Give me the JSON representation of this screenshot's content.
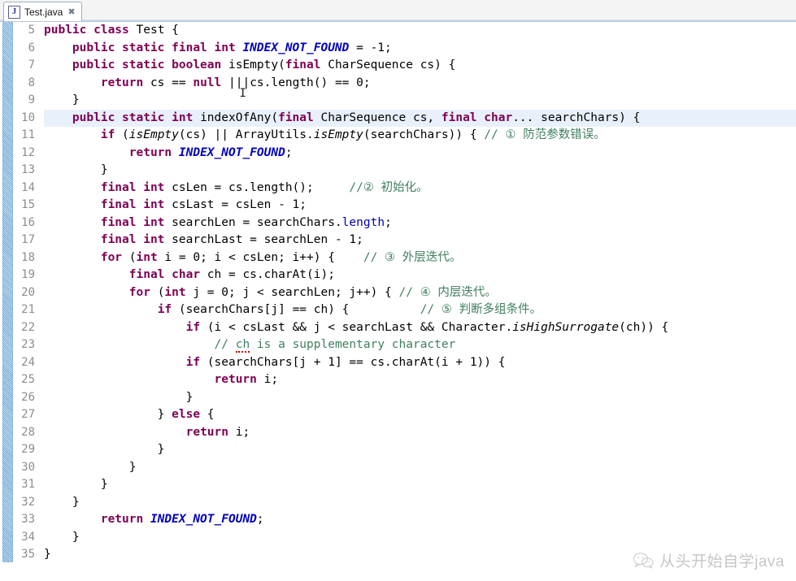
{
  "window": {
    "app": "eclipse-java-editor"
  },
  "tab": {
    "icon": "java-file-icon",
    "label": "Test.java",
    "close_glyph": "✖"
  },
  "gutter": {
    "first_line": 5,
    "last_line": 35,
    "fold_lines": [
      7,
      10
    ],
    "line_numbers": [
      5,
      6,
      7,
      8,
      9,
      10,
      11,
      12,
      13,
      14,
      15,
      16,
      17,
      18,
      19,
      20,
      21,
      22,
      23,
      24,
      25,
      26,
      27,
      28,
      29,
      30,
      31,
      32,
      33,
      34,
      35
    ]
  },
  "editor": {
    "current_line": 10,
    "colors": {
      "keyword": "#7f0055",
      "static_field": "#0000c0",
      "comment": "#3f7f5f",
      "string": "#2a00ff",
      "current_line_bg": "#e8f0fb",
      "background": "#ffffff",
      "line_number": "#8d8d8d"
    },
    "lines": [
      {
        "n": 5,
        "segments": [
          {
            "t": "public class ",
            "c": "kw"
          },
          {
            "t": "Test {",
            "c": "plain"
          }
        ]
      },
      {
        "n": 6,
        "segments": [
          {
            "t": "    ",
            "c": "plain"
          },
          {
            "t": "public static final int ",
            "c": "kw"
          },
          {
            "t": "INDEX_NOT_FOUND",
            "c": "sfld"
          },
          {
            "t": " = -1;",
            "c": "plain"
          }
        ]
      },
      {
        "n": 7,
        "segments": [
          {
            "t": "    ",
            "c": "plain"
          },
          {
            "t": "public static boolean ",
            "c": "kw"
          },
          {
            "t": "isEmpty(",
            "c": "plain"
          },
          {
            "t": "final ",
            "c": "kw"
          },
          {
            "t": "CharSequence cs) {",
            "c": "plain"
          }
        ]
      },
      {
        "n": 8,
        "segments": [
          {
            "t": "        ",
            "c": "plain"
          },
          {
            "t": "return ",
            "c": "kw"
          },
          {
            "t": "cs == ",
            "c": "plain"
          },
          {
            "t": "null",
            "c": "kw"
          },
          {
            "t": " ||",
            "c": "plain"
          },
          {
            "t": "|cs.length() == 0;",
            "c": "plain"
          }
        ]
      },
      {
        "n": 9,
        "segments": [
          {
            "t": "    }",
            "c": "plain"
          }
        ]
      },
      {
        "n": 10,
        "segments": [
          {
            "t": "    ",
            "c": "plain"
          },
          {
            "t": "public static int ",
            "c": "kw"
          },
          {
            "t": "indexOfAny(",
            "c": "plain"
          },
          {
            "t": "final ",
            "c": "kw"
          },
          {
            "t": "CharSequence cs, ",
            "c": "plain"
          },
          {
            "t": "final char",
            "c": "kw"
          },
          {
            "t": "... searchChars) {",
            "c": "plain"
          }
        ]
      },
      {
        "n": 11,
        "segments": [
          {
            "t": "        ",
            "c": "plain"
          },
          {
            "t": "if ",
            "c": "kw"
          },
          {
            "t": "(",
            "c": "plain"
          },
          {
            "t": "isEmpty",
            "c": "mth"
          },
          {
            "t": "(cs) || ArrayUtils.",
            "c": "plain"
          },
          {
            "t": "isEmpty",
            "c": "mth"
          },
          {
            "t": "(searchChars)) { ",
            "c": "plain"
          },
          {
            "t": "// ① 防范参数错误。",
            "c": "cmt"
          }
        ]
      },
      {
        "n": 12,
        "segments": [
          {
            "t": "            ",
            "c": "plain"
          },
          {
            "t": "return ",
            "c": "kw"
          },
          {
            "t": "INDEX_NOT_FOUND",
            "c": "sfld"
          },
          {
            "t": ";",
            "c": "plain"
          }
        ]
      },
      {
        "n": 13,
        "segments": [
          {
            "t": "        }",
            "c": "plain"
          }
        ]
      },
      {
        "n": 14,
        "segments": [
          {
            "t": "        ",
            "c": "plain"
          },
          {
            "t": "final int ",
            "c": "kw"
          },
          {
            "t": "csLen = cs.length();     ",
            "c": "plain"
          },
          {
            "t": "//② 初始化。",
            "c": "cmt"
          }
        ]
      },
      {
        "n": 15,
        "segments": [
          {
            "t": "        ",
            "c": "plain"
          },
          {
            "t": "final int ",
            "c": "kw"
          },
          {
            "t": "csLast = csLen - 1;",
            "c": "plain"
          }
        ]
      },
      {
        "n": 16,
        "segments": [
          {
            "t": "        ",
            "c": "plain"
          },
          {
            "t": "final int ",
            "c": "kw"
          },
          {
            "t": "searchLen = searchChars.",
            "c": "plain"
          },
          {
            "t": "length",
            "c": "fld"
          },
          {
            "t": ";",
            "c": "plain"
          }
        ]
      },
      {
        "n": 17,
        "segments": [
          {
            "t": "        ",
            "c": "plain"
          },
          {
            "t": "final int ",
            "c": "kw"
          },
          {
            "t": "searchLast = searchLen - 1;",
            "c": "plain"
          }
        ]
      },
      {
        "n": 18,
        "segments": [
          {
            "t": "        ",
            "c": "plain"
          },
          {
            "t": "for ",
            "c": "kw"
          },
          {
            "t": "(",
            "c": "plain"
          },
          {
            "t": "int ",
            "c": "kw"
          },
          {
            "t": "i = 0; i < csLen; i++) {    ",
            "c": "plain"
          },
          {
            "t": "// ③ 外层迭代。",
            "c": "cmt"
          }
        ]
      },
      {
        "n": 19,
        "segments": [
          {
            "t": "            ",
            "c": "plain"
          },
          {
            "t": "final char ",
            "c": "kw"
          },
          {
            "t": "ch = cs.charAt(i);",
            "c": "plain"
          }
        ]
      },
      {
        "n": 20,
        "segments": [
          {
            "t": "            ",
            "c": "plain"
          },
          {
            "t": "for ",
            "c": "kw"
          },
          {
            "t": "(",
            "c": "plain"
          },
          {
            "t": "int ",
            "c": "kw"
          },
          {
            "t": "j = 0; j < searchLen; j++) { ",
            "c": "plain"
          },
          {
            "t": "// ④ 内层迭代。",
            "c": "cmt"
          }
        ]
      },
      {
        "n": 21,
        "segments": [
          {
            "t": "                ",
            "c": "plain"
          },
          {
            "t": "if ",
            "c": "kw"
          },
          {
            "t": "(searchChars[j] == ch) {          ",
            "c": "plain"
          },
          {
            "t": "// ⑤ 判断多组条件。",
            "c": "cmt"
          }
        ]
      },
      {
        "n": 22,
        "segments": [
          {
            "t": "                    ",
            "c": "plain"
          },
          {
            "t": "if ",
            "c": "kw"
          },
          {
            "t": "(i < csLast && j < searchLast && Character.",
            "c": "plain"
          },
          {
            "t": "isHighSurrogate",
            "c": "mth"
          },
          {
            "t": "(ch)) {",
            "c": "plain"
          }
        ]
      },
      {
        "n": 23,
        "segments": [
          {
            "t": "                        ",
            "c": "plain"
          },
          {
            "t": "// ch is a supplementary character",
            "c": "cmt",
            "spell": "ch"
          }
        ]
      },
      {
        "n": 24,
        "segments": [
          {
            "t": "                    ",
            "c": "plain"
          },
          {
            "t": "if ",
            "c": "kw"
          },
          {
            "t": "(searchChars[j + 1] == cs.charAt(i + 1)) {",
            "c": "plain"
          }
        ]
      },
      {
        "n": 25,
        "segments": [
          {
            "t": "                        ",
            "c": "plain"
          },
          {
            "t": "return ",
            "c": "kw"
          },
          {
            "t": "i;",
            "c": "plain"
          }
        ]
      },
      {
        "n": 26,
        "segments": [
          {
            "t": "                    }",
            "c": "plain"
          }
        ]
      },
      {
        "n": 27,
        "segments": [
          {
            "t": "                } ",
            "c": "plain"
          },
          {
            "t": "else ",
            "c": "kw"
          },
          {
            "t": "{",
            "c": "plain"
          }
        ]
      },
      {
        "n": 28,
        "segments": [
          {
            "t": "                    ",
            "c": "plain"
          },
          {
            "t": "return ",
            "c": "kw"
          },
          {
            "t": "i;",
            "c": "plain"
          }
        ]
      },
      {
        "n": 29,
        "segments": [
          {
            "t": "                }",
            "c": "plain"
          }
        ]
      },
      {
        "n": 30,
        "segments": [
          {
            "t": "            }",
            "c": "plain"
          }
        ]
      },
      {
        "n": 31,
        "segments": [
          {
            "t": "        }",
            "c": "plain"
          }
        ]
      },
      {
        "n": 32,
        "segments": [
          {
            "t": "    }",
            "c": "plain"
          }
        ]
      },
      {
        "n": 33,
        "segments": [
          {
            "t": "        ",
            "c": "plain"
          },
          {
            "t": "return ",
            "c": "kw"
          },
          {
            "t": "INDEX_NOT_FOUND",
            "c": "sfld"
          },
          {
            "t": ";",
            "c": "plain"
          }
        ]
      },
      {
        "n": 34,
        "segments": [
          {
            "t": "    }",
            "c": "plain"
          }
        ]
      },
      {
        "n": 35,
        "segments": [
          {
            "t": "}",
            "c": "plain"
          }
        ]
      }
    ]
  },
  "watermark": {
    "icon": "wechat-icon",
    "text": "从头开始自学java"
  }
}
